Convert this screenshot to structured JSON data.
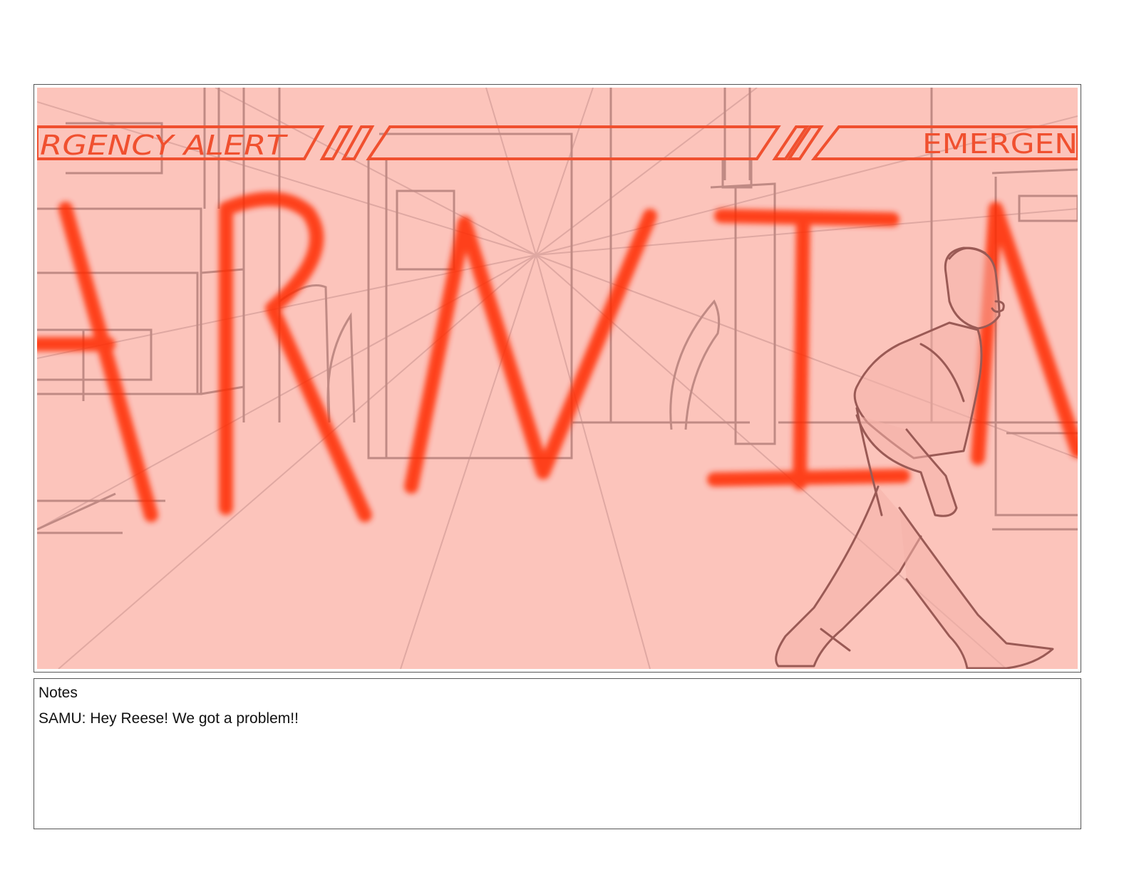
{
  "storyboard_panel": {
    "sign_left_text": "RGENCY ALERT",
    "sign_right_text": "EMERGEN",
    "warning_letters": [
      "A",
      "R",
      "N",
      "I",
      "N"
    ],
    "colors": {
      "background_tint": "#fcc4bb",
      "sign_stroke": "#f0502f",
      "warning_letters": "#ff2a00",
      "sketch_lines": "#c08a84",
      "character_lines": "#9a5a55"
    }
  },
  "notes": {
    "heading": "Notes",
    "text": "SAMU: Hey Reese! We got a problem!!"
  }
}
